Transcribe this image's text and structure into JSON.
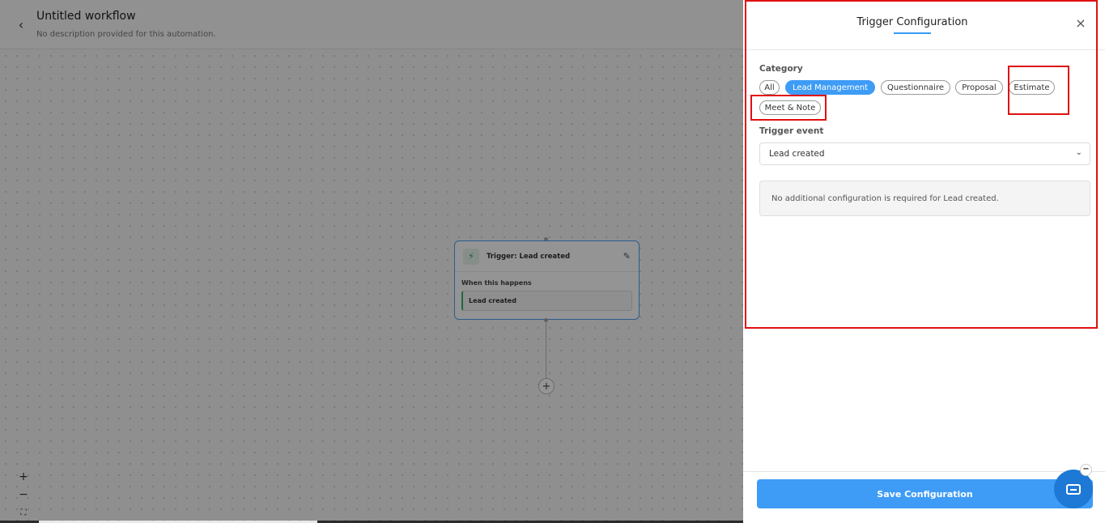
{
  "workflow": {
    "title": "Untitled workflow",
    "description": "No description provided for this automation."
  },
  "node": {
    "title": "Trigger: Lead created",
    "section_label": "When this happens",
    "event": "Lead created"
  },
  "zoom": {
    "in": "+",
    "out": "−",
    "fit": "⛶"
  },
  "panel": {
    "title": "Trigger Configuration",
    "close": "×",
    "category_label": "Category",
    "categories": [
      "All",
      "Lead Management",
      "Questionnaire",
      "Proposal",
      "Estimate",
      "Meet & Note"
    ],
    "active_category": "Lead Management",
    "trigger_event_label": "Trigger event",
    "trigger_event_value": "Lead created",
    "info": "No additional configuration is required for Lead created.",
    "save_label": "Save Configuration"
  },
  "colors": {
    "accent": "#3e9cf6",
    "highlight": "#e01010",
    "trigger_icon": "#2e9e5e"
  }
}
